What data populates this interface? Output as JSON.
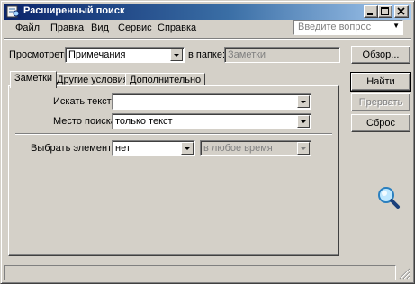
{
  "window": {
    "title": "Расширенный поиск"
  },
  "menu": {
    "items": [
      {
        "label": "Файл"
      },
      {
        "label": "Правка"
      },
      {
        "label": "Вид"
      },
      {
        "label": "Сервис"
      },
      {
        "label": "Справка"
      }
    ],
    "help_placeholder": "Введите вопрос"
  },
  "look_in": {
    "label": "Просмотреть:",
    "value": "Примечания",
    "folder_label": "в папке:",
    "folder_value": "Заметки",
    "browse_label": "Обзор..."
  },
  "buttons": {
    "find": "Найти",
    "stop": "Прервать",
    "reset": "Сброс"
  },
  "tabs": [
    {
      "label": "Заметки",
      "active": true
    },
    {
      "label": "Другие условия",
      "active": false
    },
    {
      "label": "Дополнительно",
      "active": false
    }
  ],
  "form": {
    "search_text_label": "Искать текст:",
    "search_text_value": "",
    "search_in_label": "Место поиска:",
    "search_in_value": "только текст",
    "select_items_label": "Выбрать элементы:",
    "select_items_value": "нет",
    "time_value": "в любое время"
  },
  "colors": {
    "title_start": "#0a246a",
    "title_end": "#a6caf0",
    "face": "#d4d0c8"
  }
}
